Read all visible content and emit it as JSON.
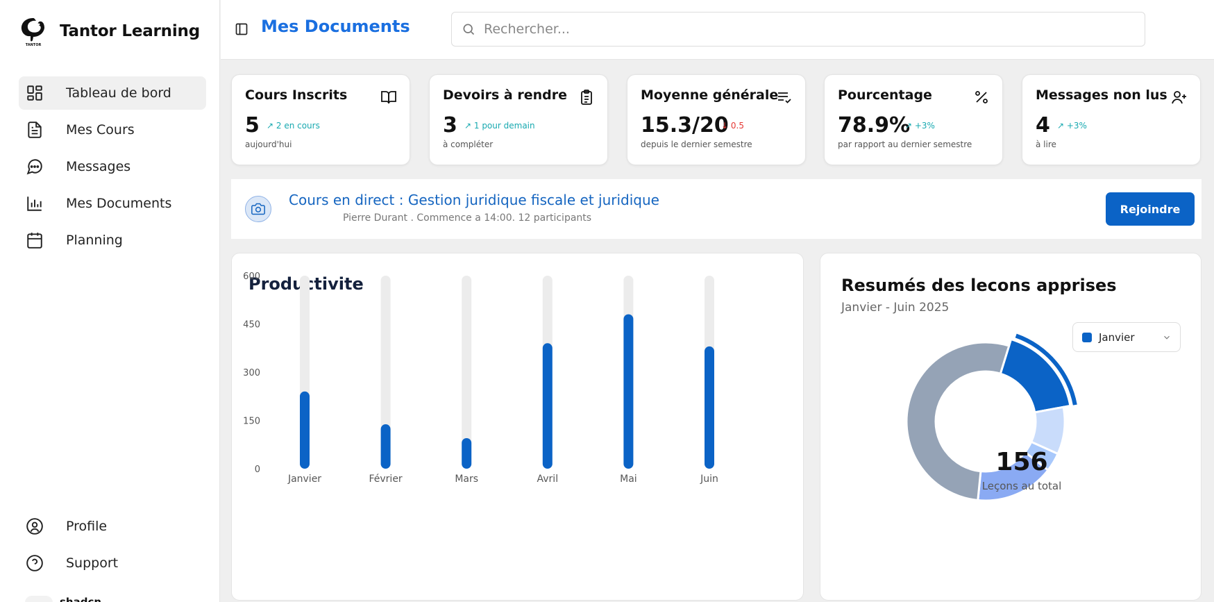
{
  "brand": {
    "name": "Tantor Learning",
    "logo_icon": "elephant-logo"
  },
  "sidebar": {
    "items": [
      {
        "label": "Tableau de bord",
        "icon": "dashboard-icon",
        "active": true
      },
      {
        "label": "Mes Cours",
        "icon": "file-text-icon",
        "active": false
      },
      {
        "label": "Messages",
        "icon": "message-icon",
        "active": false
      },
      {
        "label": "Mes Documents",
        "icon": "bar-chart-icon",
        "active": false
      },
      {
        "label": "Planning",
        "icon": "calendar-icon",
        "active": false
      }
    ],
    "bottom": [
      {
        "label": "Profile",
        "icon": "user-circle-icon"
      },
      {
        "label": "Support",
        "icon": "help-circle-icon"
      }
    ],
    "user": {
      "name": "shadcn"
    }
  },
  "header": {
    "title": "Mes Documents",
    "search_placeholder": "Rechercher..."
  },
  "stats": [
    {
      "title": "Cours Inscrits",
      "value": "5",
      "trend": "↗ 2 en cours",
      "trend_dir": "up",
      "sub": "aujourd'hui",
      "icon": "book-open-icon"
    },
    {
      "title": "Devoirs à rendre",
      "value": "3",
      "trend": "↗ 1 pour demain",
      "trend_dir": "up",
      "sub": "à compléter",
      "icon": "clipboard-icon"
    },
    {
      "title": "Moyenne générale",
      "value": "15.3/20",
      "trend": "↓ 0.5",
      "trend_dir": "down",
      "sub": "depuis le dernier semestre",
      "icon": "list-check-icon"
    },
    {
      "title": "Pourcentage",
      "value": "78.9%",
      "trend": "↗ +3%",
      "trend_dir": "up",
      "sub": "par rapport au dernier semestre",
      "icon": "percent-icon"
    },
    {
      "title": "Messages non lus",
      "value": "4",
      "trend": "↗ +3%",
      "trend_dir": "up",
      "sub": "à lire",
      "icon": "user-plus-icon"
    }
  ],
  "live": {
    "title": "Cours en direct : Gestion juridique fiscale et juridique",
    "subtitle": "Pierre Durant . Commence a 14:00. 12 participants",
    "join_label": "Rejoindre",
    "icon": "camera-icon"
  },
  "productivity": {
    "title": "Productivite"
  },
  "lessons": {
    "title": "Resumés des lecons apprises",
    "subtitle": "Janvier - Juin 2025",
    "selected_month": "Janvier",
    "total": "156",
    "total_label": "Leçons au total"
  },
  "colors": {
    "accent": "#0b63c6",
    "title_blue": "#1a6fe0",
    "trend_up": "#18a9b0",
    "trend_down": "#e53935"
  },
  "chart_data": [
    {
      "type": "bar",
      "title": "Productivite",
      "categories": [
        "Janvier",
        "Février",
        "Mars",
        "Avril",
        "Mai",
        "Juin"
      ],
      "values": [
        240,
        138,
        95,
        390,
        480,
        380
      ],
      "yticks": [
        0,
        150,
        300,
        450,
        600
      ],
      "ylim": [
        0,
        600
      ],
      "color": "#0b63c6",
      "track_color": "#ececec"
    },
    {
      "type": "pie",
      "title": "Resumés des lecons apprises",
      "values": [
        27,
        15,
        6,
        25,
        83
      ],
      "colors": [
        "#0b63c6",
        "#c9dcfb",
        "#a8c8fb",
        "#8aaaf3",
        "#95a3b6"
      ],
      "highlighted_index": 0
    }
  ]
}
